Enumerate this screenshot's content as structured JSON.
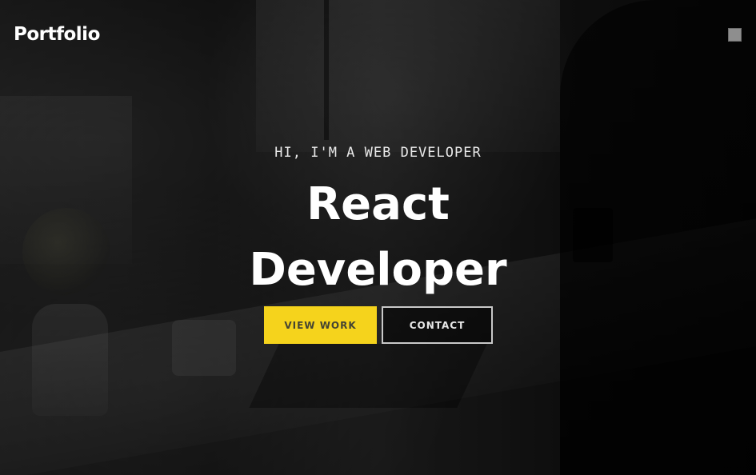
{
  "header": {
    "logo": "Portfolio",
    "menu_icon": "square-menu-icon"
  },
  "hero": {
    "intro": "HI, I'M A WEB DEVELOPER",
    "headline_line1": "React",
    "headline_line2": "Developer",
    "primary_button": "VIEW WORK",
    "secondary_button": "CONTACT"
  },
  "colors": {
    "accent": "#f5d31c",
    "text": "#ffffff",
    "background": "#151515"
  }
}
